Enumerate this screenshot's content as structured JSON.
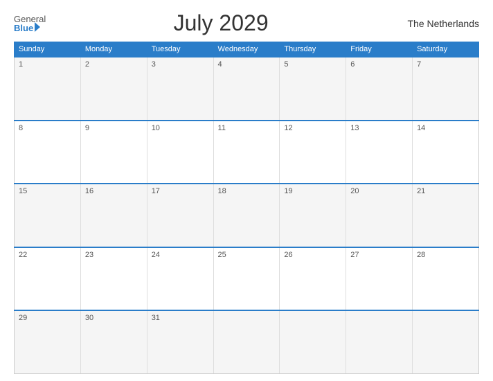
{
  "header": {
    "logo_general": "General",
    "logo_blue": "Blue",
    "month_title": "July 2029",
    "country": "The Netherlands"
  },
  "weekdays": [
    "Sunday",
    "Monday",
    "Tuesday",
    "Wednesday",
    "Thursday",
    "Friday",
    "Saturday"
  ],
  "weeks": [
    [
      {
        "day": "1",
        "empty": false
      },
      {
        "day": "2",
        "empty": false
      },
      {
        "day": "3",
        "empty": false
      },
      {
        "day": "4",
        "empty": false
      },
      {
        "day": "5",
        "empty": false
      },
      {
        "day": "6",
        "empty": false
      },
      {
        "day": "7",
        "empty": false
      }
    ],
    [
      {
        "day": "8",
        "empty": false
      },
      {
        "day": "9",
        "empty": false
      },
      {
        "day": "10",
        "empty": false
      },
      {
        "day": "11",
        "empty": false
      },
      {
        "day": "12",
        "empty": false
      },
      {
        "day": "13",
        "empty": false
      },
      {
        "day": "14",
        "empty": false
      }
    ],
    [
      {
        "day": "15",
        "empty": false
      },
      {
        "day": "16",
        "empty": false
      },
      {
        "day": "17",
        "empty": false
      },
      {
        "day": "18",
        "empty": false
      },
      {
        "day": "19",
        "empty": false
      },
      {
        "day": "20",
        "empty": false
      },
      {
        "day": "21",
        "empty": false
      }
    ],
    [
      {
        "day": "22",
        "empty": false
      },
      {
        "day": "23",
        "empty": false
      },
      {
        "day": "24",
        "empty": false
      },
      {
        "day": "25",
        "empty": false
      },
      {
        "day": "26",
        "empty": false
      },
      {
        "day": "27",
        "empty": false
      },
      {
        "day": "28",
        "empty": false
      }
    ],
    [
      {
        "day": "29",
        "empty": false
      },
      {
        "day": "30",
        "empty": false
      },
      {
        "day": "31",
        "empty": false
      },
      {
        "day": "",
        "empty": true
      },
      {
        "day": "",
        "empty": true
      },
      {
        "day": "",
        "empty": true
      },
      {
        "day": "",
        "empty": true
      }
    ]
  ]
}
